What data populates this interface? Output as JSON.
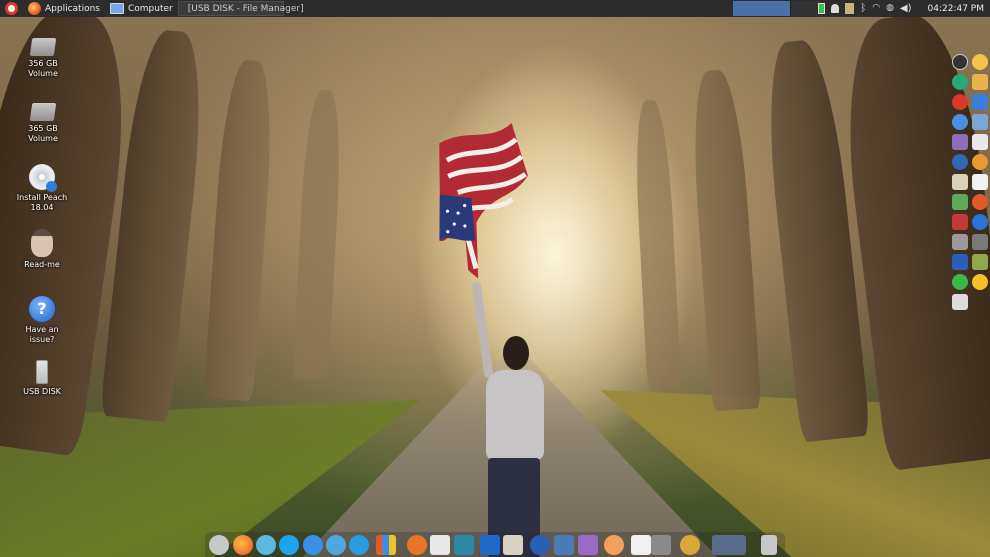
{
  "top_panel": {
    "applications_label": "Applications",
    "computer_label": "Computer",
    "window_button_label": "[USB DISK - File Manager]",
    "clock": "04:22:47 PM"
  },
  "desktop_icons": [
    {
      "label": "356 GB Volume",
      "icon": "drive-icon"
    },
    {
      "label": "365 GB Volume",
      "icon": "drive-icon"
    },
    {
      "label": "Install Peach 18.04",
      "icon": "cd-installer-icon"
    },
    {
      "label": "Read-me",
      "icon": "face-icon"
    },
    {
      "label": "Have an issue?",
      "icon": "help-icon"
    },
    {
      "label": "USB DISK",
      "icon": "usb-drive-icon"
    }
  ],
  "colors": {
    "panel_bg": "#2c2c2c",
    "workspace_active": "#4a72a9"
  }
}
